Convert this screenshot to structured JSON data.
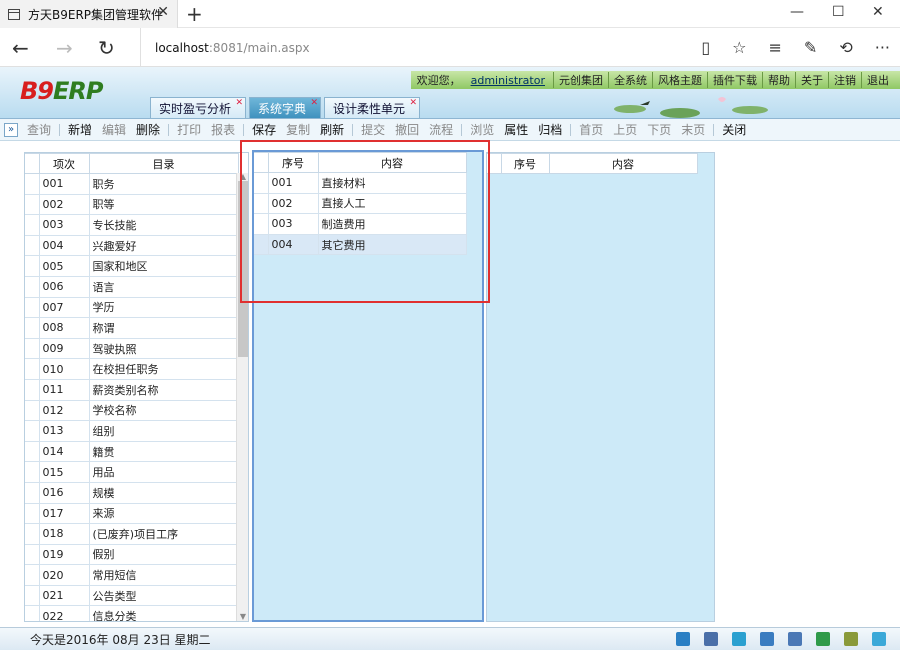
{
  "browser": {
    "tab_title": "方天B9ERP集团管理软件",
    "tab_close": "✕",
    "new_tab": "+",
    "minimize": "—",
    "maximize": "☐",
    "close": "✕",
    "url_host": "localhost",
    "url_rest": ":8081/main.aspx",
    "back": "←",
    "forward": "→",
    "refresh": "↻",
    "icons": [
      "reading-view-icon",
      "favorite-star-icon",
      "hub-icon",
      "web-note-icon",
      "share-icon",
      "more-icon"
    ]
  },
  "app": {
    "logo_b9": "B9",
    "logo_erp": "ERP",
    "welcome": "欢迎您，",
    "user": "administrator",
    "top_menu": [
      "元创集团",
      "全系统",
      "风格主题",
      "插件下载",
      "帮助",
      "关于",
      "注销",
      "退出"
    ],
    "tabs": [
      {
        "label": "实时盈亏分析",
        "active": false
      },
      {
        "label": "系统字典",
        "active": true
      },
      {
        "label": "设计柔性单元",
        "active": false
      }
    ],
    "tab_close": "✕"
  },
  "toolbar": {
    "expand": "»",
    "groups": [
      [
        {
          "label": "查询",
          "enabled": false
        }
      ],
      [
        {
          "label": "新增",
          "enabled": true
        },
        {
          "label": "编辑",
          "enabled": false
        },
        {
          "label": "删除",
          "enabled": true
        }
      ],
      [
        {
          "label": "打印",
          "enabled": false
        },
        {
          "label": "报表",
          "enabled": false
        }
      ],
      [
        {
          "label": "保存",
          "enabled": true
        },
        {
          "label": "复制",
          "enabled": false
        },
        {
          "label": "刷新",
          "enabled": true
        }
      ],
      [
        {
          "label": "提交",
          "enabled": false
        },
        {
          "label": "撤回",
          "enabled": false
        },
        {
          "label": "流程",
          "enabled": false
        }
      ],
      [
        {
          "label": "浏览",
          "enabled": false
        },
        {
          "label": "属性",
          "enabled": true
        },
        {
          "label": "归档",
          "enabled": true
        }
      ],
      [
        {
          "label": "首页",
          "enabled": false
        },
        {
          "label": "上页",
          "enabled": false
        },
        {
          "label": "下页",
          "enabled": false
        },
        {
          "label": "末页",
          "enabled": false
        }
      ],
      [
        {
          "label": "关闭",
          "enabled": true
        }
      ]
    ]
  },
  "catalog": {
    "headers": [
      "项次",
      "目录"
    ],
    "rows": [
      [
        "001",
        "职务"
      ],
      [
        "002",
        "职等"
      ],
      [
        "003",
        "专长技能"
      ],
      [
        "004",
        "兴趣爱好"
      ],
      [
        "005",
        "国家和地区"
      ],
      [
        "006",
        "语言"
      ],
      [
        "007",
        "学历"
      ],
      [
        "008",
        "称谓"
      ],
      [
        "009",
        "驾驶执照"
      ],
      [
        "010",
        "在校担任职务"
      ],
      [
        "011",
        "薪资类别名称"
      ],
      [
        "012",
        "学校名称"
      ],
      [
        "013",
        "组别"
      ],
      [
        "014",
        "籍贯"
      ],
      [
        "015",
        "用品"
      ],
      [
        "016",
        "规模"
      ],
      [
        "017",
        "来源"
      ],
      [
        "018",
        "(已废弃)项目工序"
      ],
      [
        "019",
        "假别"
      ],
      [
        "020",
        "常用短信"
      ],
      [
        "021",
        "公告类型"
      ],
      [
        "022",
        "信息分类"
      ]
    ]
  },
  "content": {
    "headers": [
      "序号",
      "内容"
    ],
    "rows": [
      [
        "001",
        "直接材料"
      ],
      [
        "002",
        "直接人工"
      ],
      [
        "003",
        "制造费用"
      ],
      [
        "004",
        "其它费用"
      ]
    ],
    "selected_index": 3
  },
  "detail": {
    "headers": [
      "序号",
      "内容"
    ]
  },
  "status": {
    "date": "今天是2016年  08月  23日    星期二",
    "icons": [
      "home-icon",
      "org-icon",
      "message-icon",
      "checkbox-icon",
      "mail-icon",
      "browser-icon",
      "calculator-icon",
      "weather-icon"
    ],
    "icon_colors": [
      "#2a7fc4",
      "#4a6fa8",
      "#2aa0d0",
      "#3a7cc0",
      "#4b78b5",
      "#2f9a4a",
      "#8a9a3a",
      "#3aa8d8"
    ]
  }
}
